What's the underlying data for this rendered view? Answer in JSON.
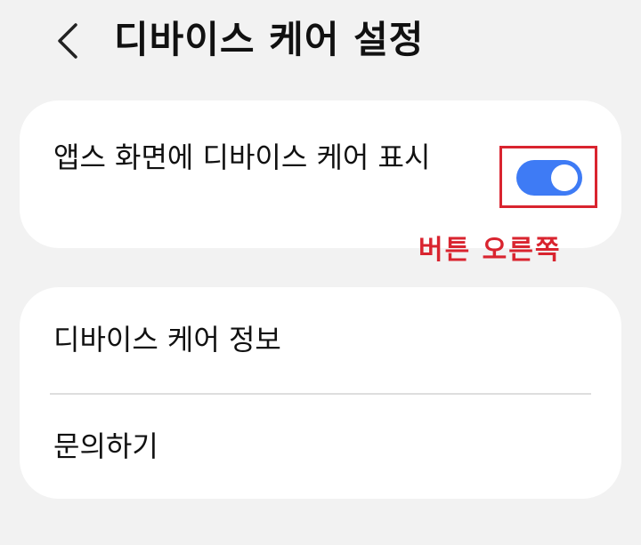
{
  "header": {
    "back_icon": "chevron-left-icon",
    "title": "디바이스 케어 설정"
  },
  "toggle_card": {
    "label": "앱스 화면에 디바이스 케어 표시",
    "toggle_state": "on",
    "toggle_color": "#3e7bf5"
  },
  "annotation": {
    "text": "버튼 오른쪽",
    "color": "#d9242f"
  },
  "menu": {
    "items": [
      {
        "label": "디바이스 케어 정보"
      },
      {
        "label": "문의하기"
      }
    ]
  }
}
